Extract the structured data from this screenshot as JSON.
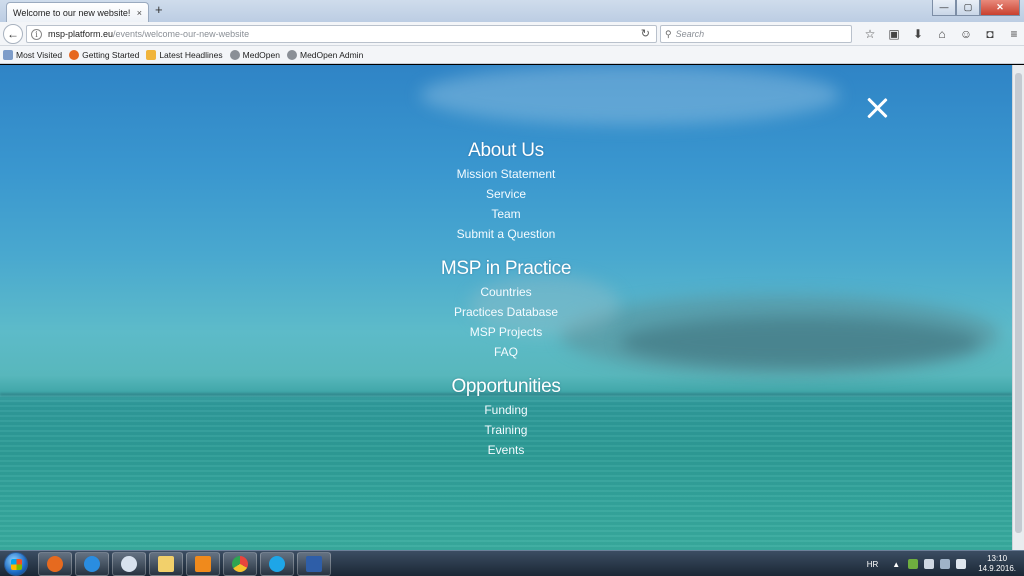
{
  "browser": {
    "tab_title": "Welcome to our new website! |...",
    "tab_close": "×",
    "new_tab": "+",
    "window_controls": [
      "—",
      "▢",
      "✕"
    ],
    "url_host": "msp-platform.eu",
    "url_path": "/events/welcome-our-new-website",
    "search_placeholder": "Search",
    "toolbar_icons": [
      "star-icon",
      "clipboard-icon",
      "download-icon",
      "home-icon",
      "chat-icon",
      "pocket-icon",
      "menu-icon"
    ]
  },
  "bookmarks": [
    {
      "label": "Most Visited",
      "icon": "#7d9cc9"
    },
    {
      "label": "Getting Started",
      "icon": "#e6671f"
    },
    {
      "label": "Latest Headlines",
      "icon": "#f0b43b"
    },
    {
      "label": "MedOpen",
      "icon": "#8a8f96"
    },
    {
      "label": "MedOpen Admin",
      "icon": "#8a8f96"
    }
  ],
  "menu": {
    "sections": [
      {
        "heading": "About Us",
        "links": [
          "Mission Statement",
          "Service",
          "Team",
          "Submit a Question"
        ]
      },
      {
        "heading": "MSP in Practice",
        "links": [
          "Countries",
          "Practices Database",
          "MSP Projects",
          "FAQ"
        ]
      },
      {
        "heading": "Opportunities",
        "links": [
          "Funding",
          "Training",
          "Events"
        ]
      }
    ]
  },
  "taskbar": {
    "apps": [
      {
        "name": "firefox",
        "color": "#e66a1f"
      },
      {
        "name": "internet-explorer",
        "color": "#2a8de0"
      },
      {
        "name": "outlook",
        "color": "#d8e2ee"
      },
      {
        "name": "explorer",
        "color": "#f2d06b"
      },
      {
        "name": "media-player",
        "color": "#f08a1c"
      },
      {
        "name": "chrome",
        "color": "#e9453c"
      },
      {
        "name": "skype",
        "color": "#1ea6e8"
      },
      {
        "name": "word",
        "color": "#2e5ea8"
      }
    ],
    "language": "HR",
    "time": "13:10",
    "date": "14.9.2016."
  }
}
